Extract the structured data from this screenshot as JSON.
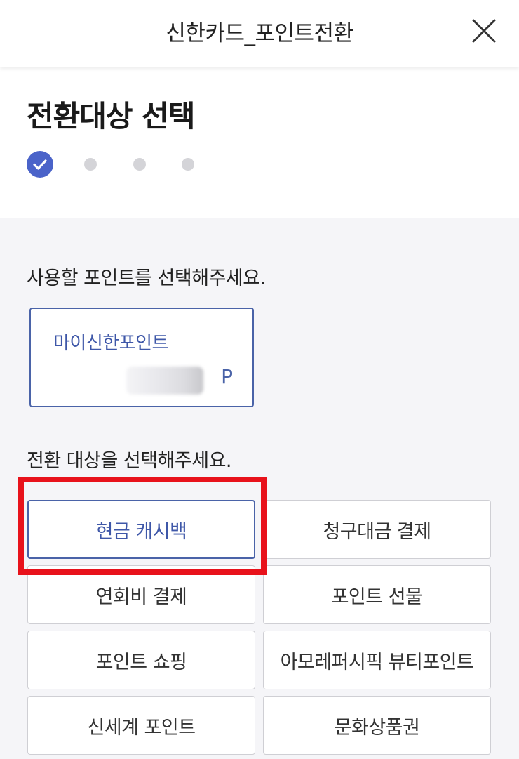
{
  "header": {
    "title": "신한카드_포인트전환",
    "close_icon": "close-icon"
  },
  "page": {
    "title": "전환대상 선택",
    "steps": {
      "total": 4,
      "current": 1
    }
  },
  "source": {
    "label": "사용할 포인트를 선택해주세요.",
    "card": {
      "name": "마이신한포인트",
      "unit": "P"
    }
  },
  "target": {
    "label": "전환 대상을 선택해주세요.",
    "options": [
      {
        "label": "현금 캐시백"
      },
      {
        "label": "청구대금 결제"
      },
      {
        "label": "연회비 결제"
      },
      {
        "label": "포인트 선물"
      },
      {
        "label": "포인트 쇼핑"
      },
      {
        "label": "아모레퍼시픽 뷰티포인트"
      },
      {
        "label": "신세계 포인트"
      },
      {
        "label": "문화상품권"
      }
    ],
    "selected": "현금 캐시백"
  },
  "colors": {
    "accent": "#4a63c9",
    "selected_border": "#4a63a8",
    "highlight": "#e8121b"
  }
}
